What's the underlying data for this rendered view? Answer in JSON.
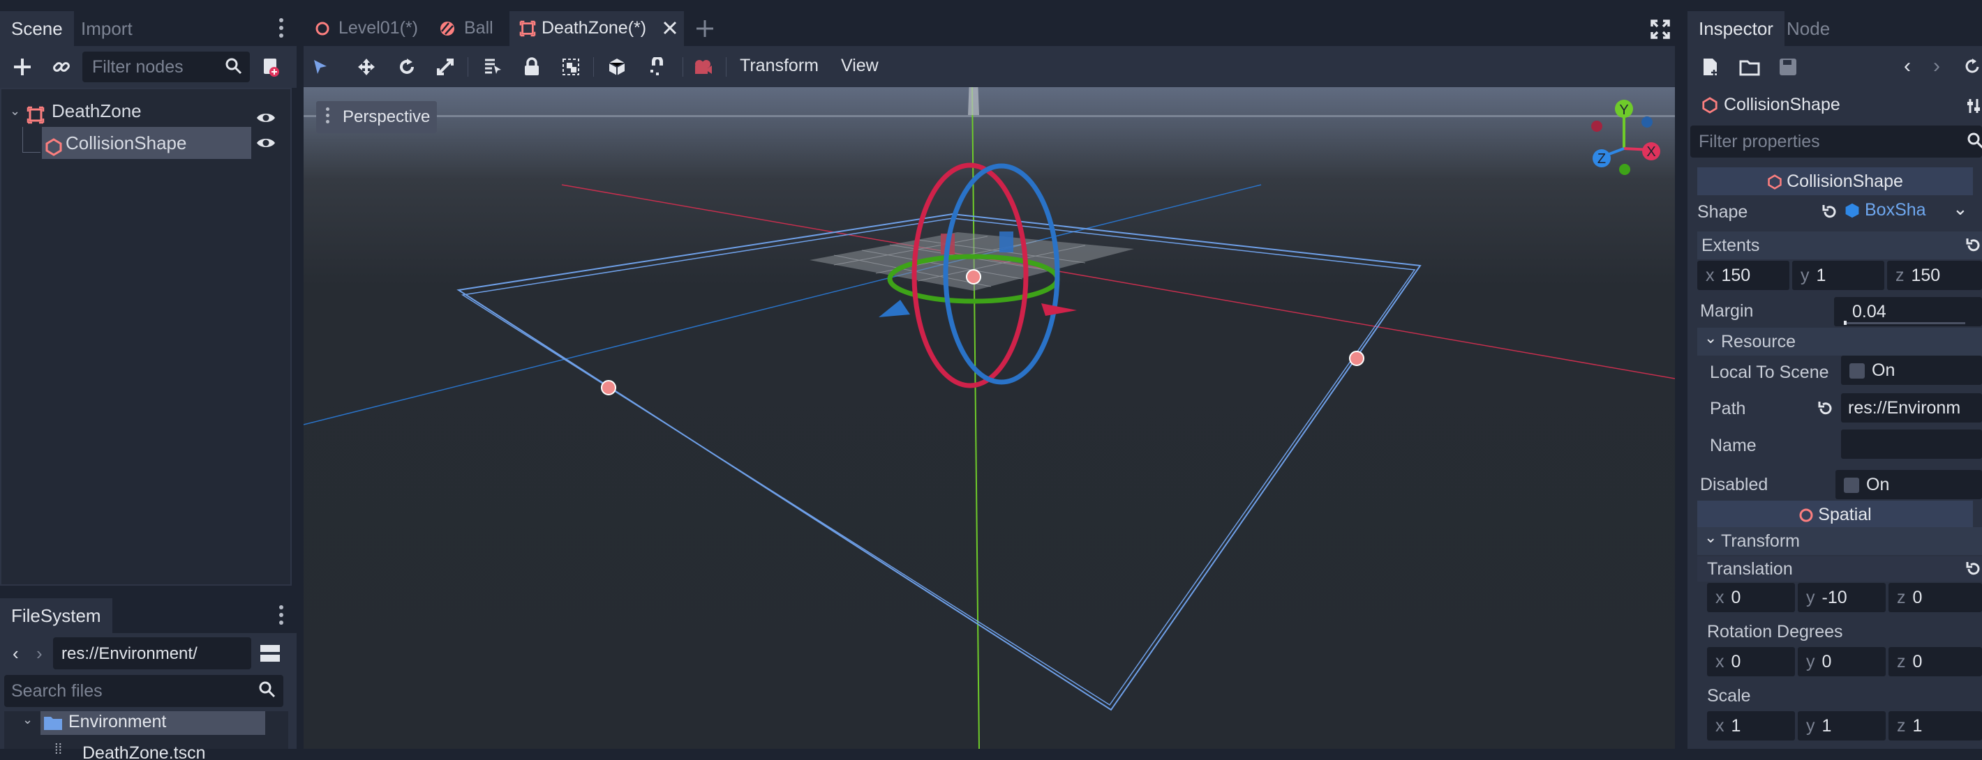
{
  "scene_dock": {
    "tabs": [
      "Scene",
      "Import"
    ],
    "filter_placeholder": "Filter nodes",
    "tree": [
      {
        "label": "DeathZone",
        "visible": true
      },
      {
        "label": "CollisionShape",
        "visible": true,
        "selected": true
      }
    ]
  },
  "filesystem_dock": {
    "tab": "FileSystem",
    "path": "res://Environment/",
    "search_placeholder": "Search files",
    "items": [
      "Environment",
      "DeathZone.tscn"
    ]
  },
  "editor": {
    "tabs": [
      {
        "label": "Level01(*)",
        "icon": "spatial-node-icon"
      },
      {
        "label": "Ball",
        "icon": "rigidbody-icon"
      },
      {
        "label": "DeathZone(*)",
        "icon": "area-icon",
        "active": true
      }
    ],
    "menus": {
      "transform": "Transform",
      "view": "View"
    },
    "viewport_label": "Perspective",
    "gizmo_axes": {
      "x": "X",
      "y": "Y",
      "z": "Z"
    }
  },
  "inspector": {
    "tabs": [
      "Inspector",
      "Node"
    ],
    "object_name": "CollisionShape",
    "filter_placeholder": "Filter properties",
    "sections": {
      "collision_shape": "CollisionShape",
      "spatial": "Spatial"
    },
    "shape": {
      "label": "Shape",
      "value": "BoxSha"
    },
    "extents": {
      "label": "Extents",
      "x": "150",
      "y": "1",
      "z": "150"
    },
    "margin": {
      "label": "Margin",
      "value": "0.04"
    },
    "resource": {
      "label": "Resource",
      "local_to_scene": {
        "label": "Local To Scene",
        "value": "On"
      },
      "path": {
        "label": "Path",
        "value": "res://Environm"
      },
      "name": {
        "label": "Name",
        "value": ""
      }
    },
    "disabled": {
      "label": "Disabled",
      "value": "On"
    },
    "transform": {
      "label": "Transform",
      "translation": {
        "label": "Translation",
        "x": "0",
        "y": "-10",
        "z": "0"
      },
      "rotation": {
        "label": "Rotation Degrees",
        "x": "0",
        "y": "0",
        "z": "0"
      },
      "scale": {
        "label": "Scale",
        "x": "1",
        "y": "1",
        "z": "1"
      }
    },
    "axis_letters": {
      "x": "x",
      "y": "y",
      "z": "z"
    }
  },
  "colors": {
    "x_axis": "#e0335c",
    "y_axis": "#86d62c",
    "z_axis": "#2f88e6",
    "accent": "#7aa2e8",
    "selection": "#4a5163"
  }
}
